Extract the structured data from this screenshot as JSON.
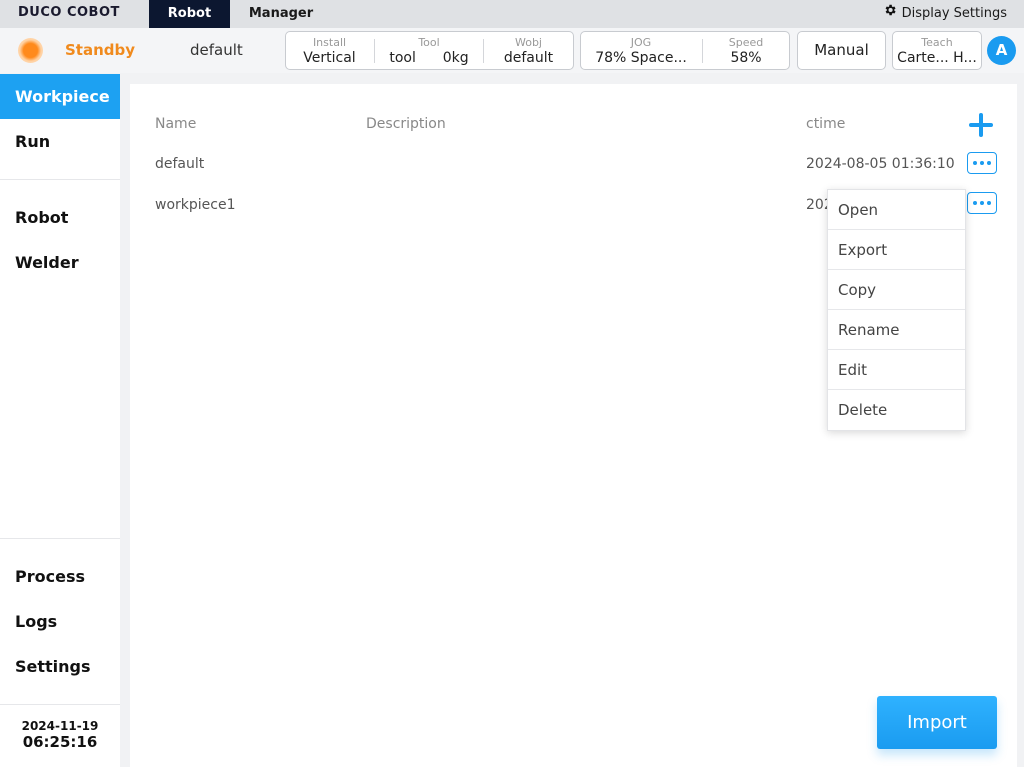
{
  "brand": {
    "logo_text": "DUCO COBOT"
  },
  "top_tabs": [
    {
      "label": "Robot",
      "active": true
    },
    {
      "label": "Manager",
      "active": false
    }
  ],
  "display_settings": {
    "label": "Display Settings",
    "icon": "gear-icon"
  },
  "status": {
    "state": "Standby",
    "state_color": "#f08a1d",
    "project": "default",
    "install": {
      "label": "Install",
      "value": "Vertical"
    },
    "tool": {
      "label": "Tool",
      "name": "tool",
      "payload": "0kg"
    },
    "wobj": {
      "label": "Wobj",
      "value": "default"
    },
    "jog": {
      "label": "JOG",
      "percent": "78%",
      "mode": "Space..."
    },
    "speed": {
      "label": "Speed",
      "value": "58%"
    },
    "mode_button": "Manual",
    "teach": {
      "label": "Teach",
      "value": "Carte... H..."
    },
    "avatar": "A"
  },
  "sidebar": {
    "items": [
      {
        "label": "Workpiece",
        "active": true
      },
      {
        "label": "Run",
        "active": false
      },
      {
        "label": "Robot",
        "active": false
      },
      {
        "label": "Welder",
        "active": false
      },
      {
        "label": "Process",
        "active": false
      },
      {
        "label": "Logs",
        "active": false
      },
      {
        "label": "Settings",
        "active": false
      }
    ],
    "date": "2024-11-19",
    "time": "06:25:16"
  },
  "table": {
    "headers": {
      "name": "Name",
      "description": "Description",
      "ctime": "ctime"
    },
    "rows": [
      {
        "name": "default",
        "description": "",
        "ctime": "2024-08-05 01:36:10"
      },
      {
        "name": "workpiece1",
        "description": "",
        "ctime": "202"
      }
    ]
  },
  "context_menu": {
    "items": [
      "Open",
      "Export",
      "Copy",
      "Rename",
      "Edit",
      "Delete"
    ]
  },
  "import_button": "Import",
  "colors": {
    "accent": "#1a9bf0",
    "active_nav": "#1da1f2",
    "tab_dark": "#0c1730"
  }
}
